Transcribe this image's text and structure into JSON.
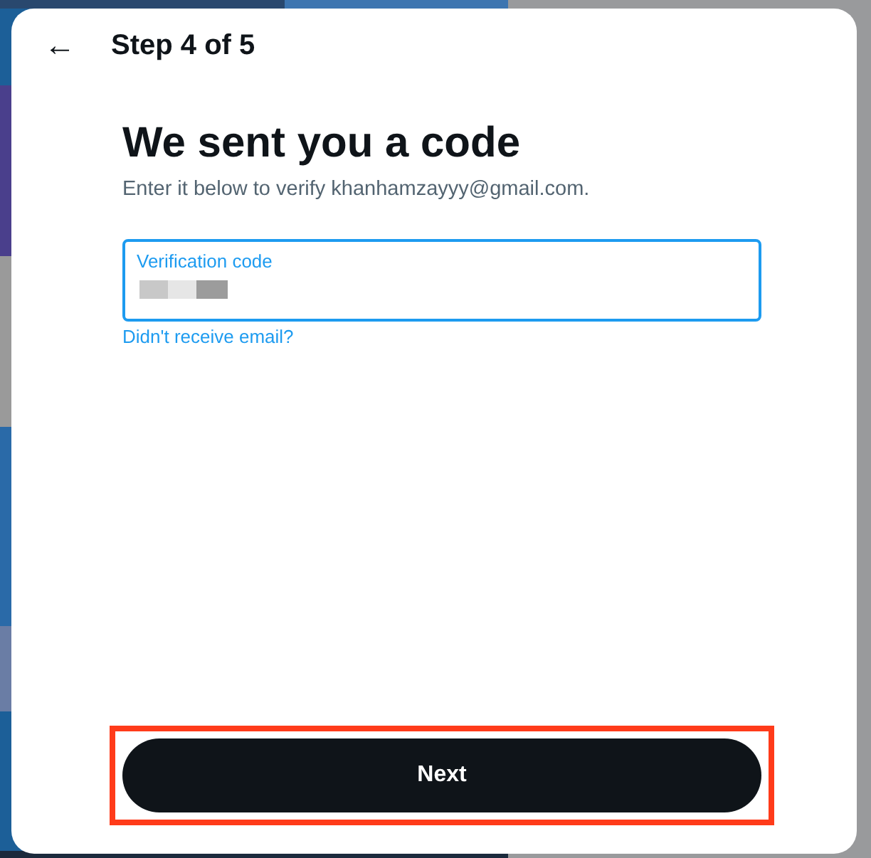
{
  "dialog": {
    "back": "←",
    "step": "Step 4 of 5",
    "title": "We sent you a code",
    "subtitle": "Enter it below to verify khanhamzayyy@gmail.com."
  },
  "field": {
    "label": "Verification code",
    "focused": true,
    "redacted": true
  },
  "link": "Didn't receive email?",
  "next_button": {
    "label": "Next",
    "highlighted": true
  }
}
